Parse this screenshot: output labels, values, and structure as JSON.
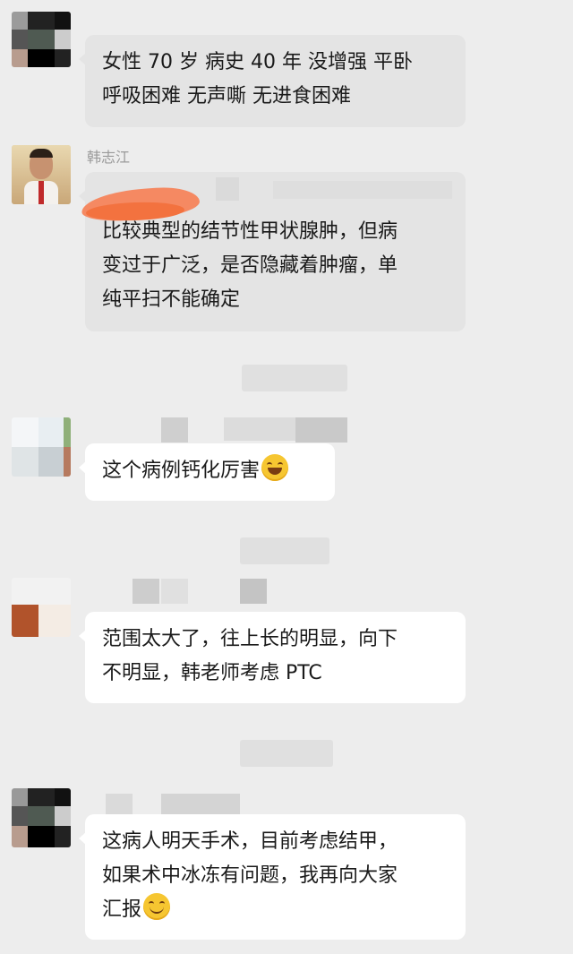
{
  "messages": [
    {
      "lines": [
        "女性 70 岁 病史 40 年 没增强  平卧",
        "呼吸困难 无声嘶 无进食困难"
      ]
    },
    {
      "sender": "韩志江",
      "lines": [
        "比较典型的结节性甲状腺肿，但病",
        "变过于广泛，是否隐藏着肿瘤，单",
        "纯平扫不能确定"
      ]
    },
    {
      "text": "这个病例钙化厉害",
      "emoji": "grinning-face-icon"
    },
    {
      "lines": [
        "范围太大了，往上长的明显，向下",
        "不明显，韩老师考虑 PTC"
      ]
    },
    {
      "lines": [
        "这病人明天手术，目前考虑结甲，",
        "如果术中冰冻有问题，我再向大家"
      ],
      "last_line": "汇报",
      "emoji": "smiling-face-icon"
    }
  ]
}
